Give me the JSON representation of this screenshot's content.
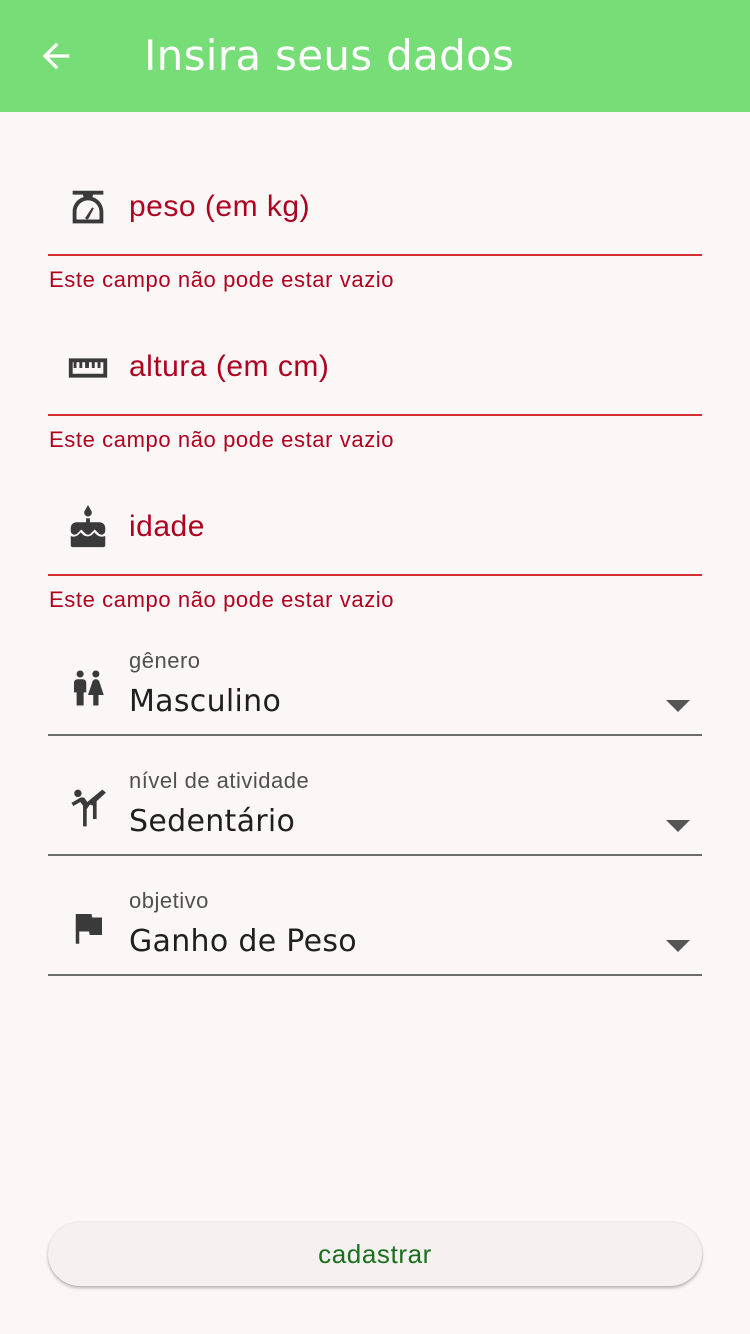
{
  "appbar": {
    "title": "Insira seus dados",
    "back_icon": "arrow-left-icon"
  },
  "fields": {
    "weight": {
      "placeholder": "peso (em kg)",
      "error": "Este campo não pode estar vazio",
      "icon": "scale-icon"
    },
    "height": {
      "placeholder": "altura (em cm)",
      "error": "Este campo não pode estar vazio",
      "icon": "ruler-icon"
    },
    "age": {
      "placeholder": "idade",
      "error": "Este campo não pode estar vazio",
      "icon": "cake-icon"
    }
  },
  "dropdowns": {
    "gender": {
      "label": "gênero",
      "value": "Masculino",
      "icon": "wc-icon"
    },
    "activity": {
      "label": "nível de atividade",
      "value": "Sedentário",
      "icon": "sports-martial-arts-icon"
    },
    "goal": {
      "label": "objetivo",
      "value": "Ganho de Peso",
      "icon": "flag-icon"
    }
  },
  "submit": {
    "label": "cadastrar"
  },
  "colors": {
    "appbar": "#77dd77",
    "error": "#b00020",
    "button_text": "#1b6e1b",
    "background": "#fbf7f6"
  }
}
